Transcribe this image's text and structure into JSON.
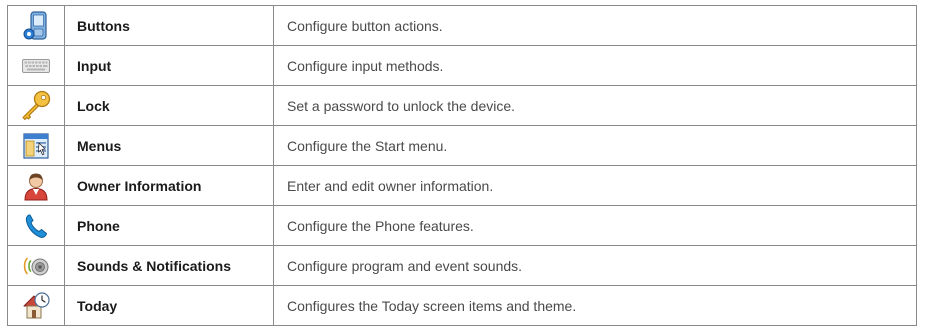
{
  "rows": [
    {
      "icon": "pda-buttons-icon",
      "name": "Buttons",
      "description": "Configure button actions."
    },
    {
      "icon": "keyboard-icon",
      "name": "Input",
      "description": "Configure input methods."
    },
    {
      "icon": "key-icon",
      "name": "Lock",
      "description": "Set a password to unlock the device."
    },
    {
      "icon": "menu-window-icon",
      "name": "Menus",
      "description": "Configure the Start menu."
    },
    {
      "icon": "owner-person-icon",
      "name": "Owner Information",
      "description": "Enter and edit owner information."
    },
    {
      "icon": "phone-handset-icon",
      "name": "Phone",
      "description": "Configure the Phone features."
    },
    {
      "icon": "speaker-sound-icon",
      "name": "Sounds & Notifications",
      "description": "Configure program and event sounds."
    },
    {
      "icon": "today-house-clock-icon",
      "name": "Today",
      "description": "Configures the Today screen items and theme."
    }
  ]
}
